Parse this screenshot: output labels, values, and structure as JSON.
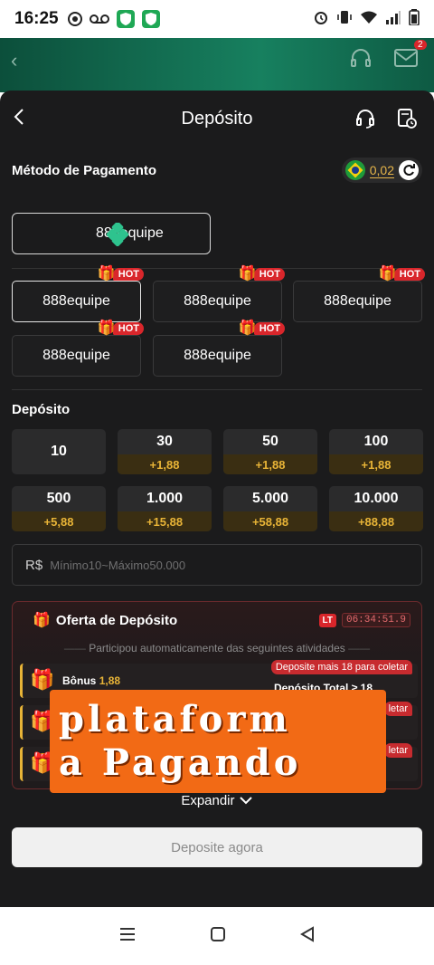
{
  "status_bar": {
    "time": "16:25"
  },
  "notification_badge": "2",
  "header": {
    "title": "Depósito"
  },
  "payment": {
    "label": "Método de Pagamento",
    "balance": "0,02",
    "selected_method": "888equipe",
    "options": [
      {
        "label": "888equipe",
        "hot": true,
        "active": true
      },
      {
        "label": "888equipe",
        "hot": true,
        "active": false
      },
      {
        "label": "888equipe",
        "hot": true,
        "active": false
      },
      {
        "label": "888equipe",
        "hot": true,
        "active": false
      },
      {
        "label": "888equipe",
        "hot": true,
        "active": false
      }
    ],
    "hot_label": "HOT"
  },
  "deposit": {
    "label": "Depósito",
    "amounts": [
      {
        "value": "10",
        "bonus": ""
      },
      {
        "value": "30",
        "bonus": "+1,88"
      },
      {
        "value": "50",
        "bonus": "+1,88"
      },
      {
        "value": "100",
        "bonus": "+1,88"
      },
      {
        "value": "500",
        "bonus": "+5,88"
      },
      {
        "value": "1.000",
        "bonus": "+15,88"
      },
      {
        "value": "5.000",
        "bonus": "+58,88"
      },
      {
        "value": "10.000",
        "bonus": "+88,88"
      }
    ],
    "currency": "R$",
    "placeholder": "Mínimo10~Máximo50.000"
  },
  "offer": {
    "title": "Oferta de Depósito",
    "lt_label": "LT",
    "countdown": "06:34:51.9",
    "subtitle": "Participou automaticamente das seguintes atividades",
    "activity": {
      "bonus_label": "Bônus",
      "bonus_value": "1,88",
      "tag": "Deposite mais 18 para coletar",
      "total": "Depósito Total ≥ 18"
    },
    "tag_partial_1": "letar",
    "tag_partial_2": "letar"
  },
  "expand_label": "Expandir",
  "submit_label": "Deposite agora",
  "promo": {
    "line1": "plataform",
    "line2": "a Pagando"
  }
}
